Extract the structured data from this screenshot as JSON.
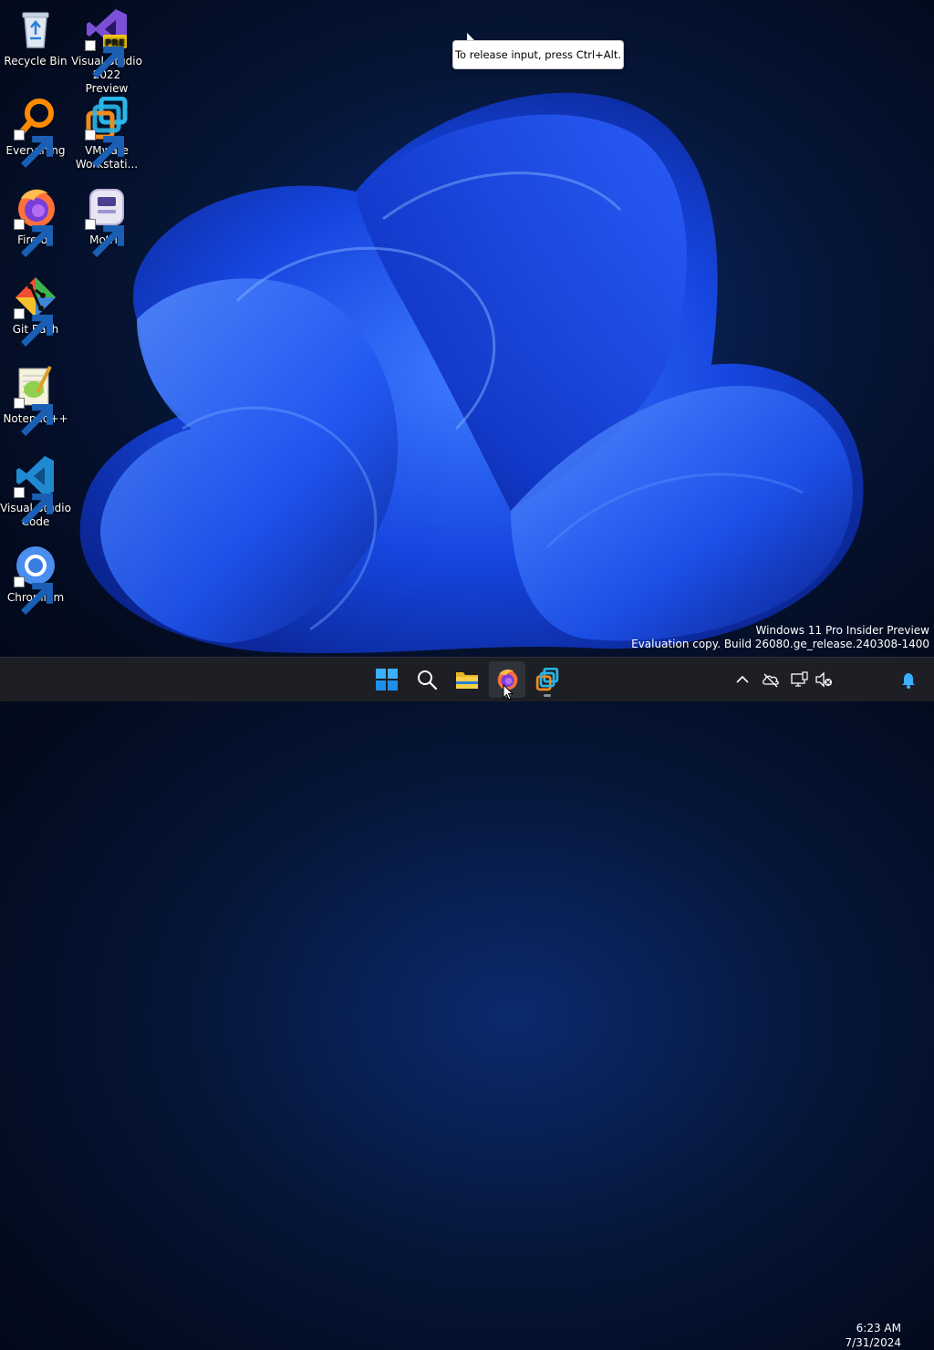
{
  "desktop": {
    "icons": [
      {
        "label": "Recycle Bin",
        "icon": "recycle-bin-icon"
      },
      {
        "label": "Visual Studio\n2022 Preview",
        "icon": "visual-studio-icon",
        "badge": "PRE"
      },
      {
        "label": "Everything",
        "icon": "everything-search-icon"
      },
      {
        "label": "VMware\nWorkstati...",
        "icon": "vmware-workstation-icon"
      },
      {
        "label": "Firefox",
        "icon": "firefox-icon"
      },
      {
        "label": "Motrix",
        "icon": "motrix-icon"
      },
      {
        "label": "Git Bash",
        "icon": "git-bash-icon"
      },
      {
        "label": "Notepad++",
        "icon": "notepad-plus-plus-icon"
      },
      {
        "label": "Visual Studio\nCode",
        "icon": "vscode-icon"
      },
      {
        "label": "Chromium",
        "icon": "chromium-icon"
      }
    ]
  },
  "tooltip": {
    "text": "To release input, press Ctrl+Alt."
  },
  "watermark": {
    "line1": "Windows 11 Pro Insider Preview",
    "line2": "Evaluation copy. Build 26080.ge_release.240308-1400"
  },
  "taskbar": {
    "apps": [
      "start-button",
      "search-button",
      "file-explorer",
      "firefox",
      "vmware-workstation"
    ],
    "active_app": "firefox"
  },
  "tray": {
    "time": "6:23 AM",
    "date": "7/31/2024",
    "icons": [
      "chevron-up-icon",
      "onedrive-icon",
      "network-icon",
      "volume-muted-icon",
      "notification-bell-icon"
    ]
  },
  "colors": {
    "accent": "#0078d4",
    "taskbar": "#1d1f24",
    "wallpaper_bloom": "#1a4dff"
  }
}
